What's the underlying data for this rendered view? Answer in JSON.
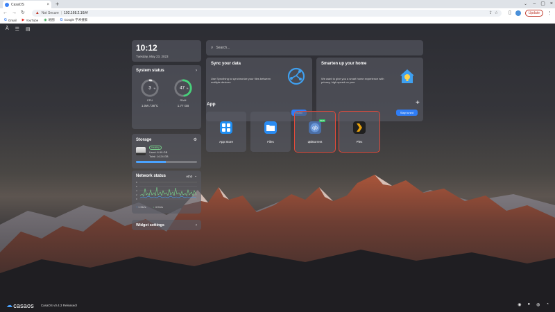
{
  "browser": {
    "tab_title": "CasaOS",
    "new_tab_label": "+",
    "security_label": "Not Secure",
    "url": "192.168.2.16/#/",
    "update_label": "Update",
    "profile_initial": "C",
    "bookmarks": [
      {
        "label": "Gmail",
        "icon": "G"
      },
      {
        "label": "YouTube",
        "icon": "▶"
      },
      {
        "label": "地图",
        "icon": "◉"
      },
      {
        "label": "Google 学术搜索",
        "icon": "G"
      }
    ]
  },
  "clock": {
    "time": "10:12",
    "date": "Tuesday, May 23, 2023"
  },
  "system_status": {
    "title": "System status",
    "cpu": {
      "percent": 3,
      "value_text": "3",
      "unit": "%",
      "label": "CPU",
      "sub": "1.0W / 36°C"
    },
    "ram": {
      "percent": 47,
      "value_text": "47",
      "unit": "%",
      "label": "RAM",
      "sub": "1.77 GB"
    }
  },
  "storage": {
    "title": "Storage",
    "status": "Healthy",
    "used": "Used: 6.99 GB",
    "total": "Total: 14.24 GB",
    "used_fraction": 0.49
  },
  "network": {
    "title": "Network status",
    "interface": "eth0",
    "y_ticks": [
      "8",
      "6",
      "4",
      "2",
      "0"
    ],
    "upload": "1 Kb/s",
    "download": "4 Kb/s"
  },
  "widget_settings": {
    "label": "Widget settings"
  },
  "search": {
    "placeholder": "Search..."
  },
  "sync_card": {
    "title": "Sync your data",
    "text": "Use Syncthing to synchronize your files between multiple devices",
    "button": "Install"
  },
  "home_card": {
    "title": "Smarten up your home",
    "text": "We want to give you a smart home experience with privacy, high speed on your",
    "button": "Stay tuned"
  },
  "apps": {
    "heading": "App",
    "add_label": "+",
    "items": [
      {
        "name": "App Store",
        "icon": "app-store-icon"
      },
      {
        "name": "Files",
        "icon": "folder-icon"
      },
      {
        "name": "qBittorrent",
        "icon": "qbittorrent-icon",
        "badge": "NEW",
        "highlighted": true
      },
      {
        "name": "Plex",
        "icon": "plex-icon",
        "highlighted": true
      }
    ]
  },
  "footer": {
    "logo_text": "casaos",
    "release": "CasaOS v0.4.3 Released!"
  },
  "colors": {
    "accent": "#2f7df6",
    "cpu_ring": "#e8e8e8",
    "ram_ring": "#46d17a",
    "highlight": "#e24a3b"
  }
}
